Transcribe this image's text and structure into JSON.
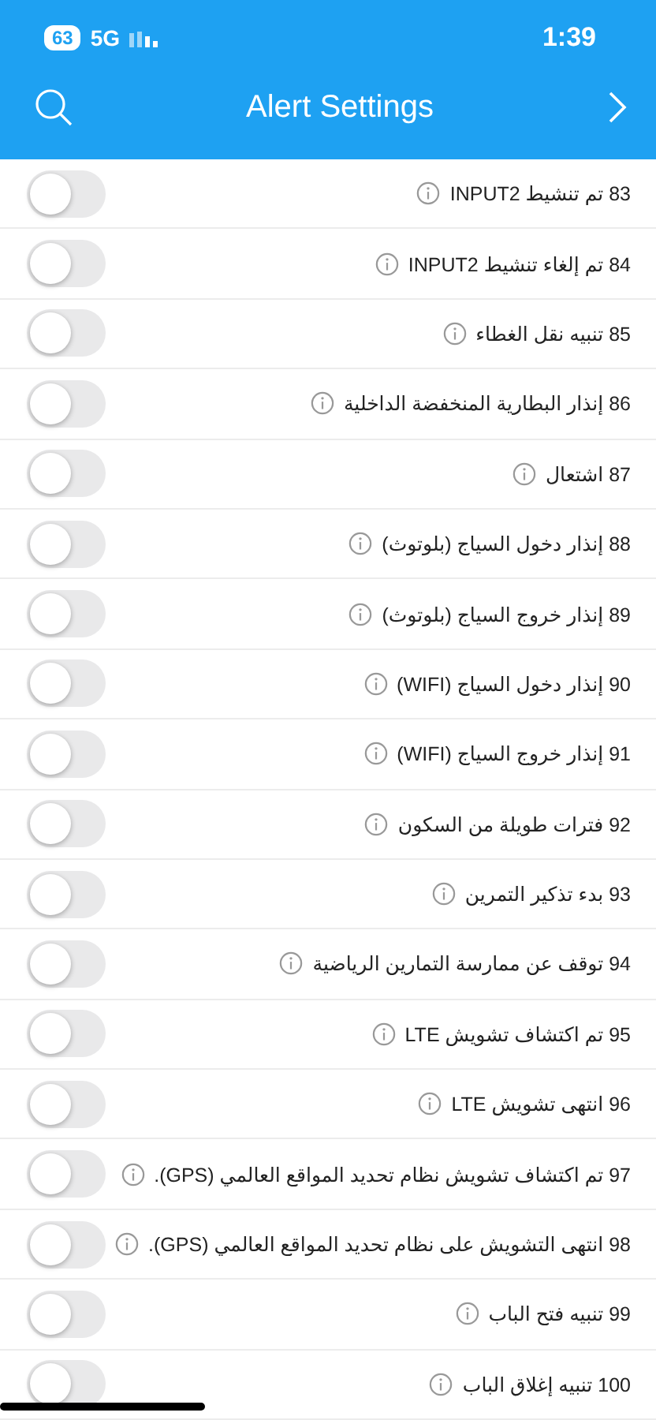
{
  "status_bar": {
    "battery": "63",
    "network": "5G",
    "time": "1:39"
  },
  "header": {
    "title": "Alert Settings"
  },
  "alerts": [
    {
      "label": "83 تم تنشيط INPUT2",
      "on": false
    },
    {
      "label": "84 تم إلغاء تنشيط INPUT2",
      "on": false
    },
    {
      "label": "85 تنبيه نقل الغطاء",
      "on": false
    },
    {
      "label": "86 إنذار البطارية المنخفضة الداخلية",
      "on": false
    },
    {
      "label": "87 اشتعال",
      "on": false
    },
    {
      "label": "88 إنذار دخول السياج (بلوتوث)",
      "on": false
    },
    {
      "label": "89 إنذار خروج السياج (بلوتوث)",
      "on": false
    },
    {
      "label": "90 إنذار دخول السياج (WIFI)",
      "on": false
    },
    {
      "label": "91 إنذار خروج السياج (WIFI)",
      "on": false
    },
    {
      "label": "92 فترات طويلة من السكون",
      "on": false
    },
    {
      "label": "93 بدء تذكير التمرين",
      "on": false
    },
    {
      "label": "94 توقف عن ممارسة التمارين الرياضية",
      "on": false
    },
    {
      "label": "95 تم اكتشاف تشويش LTE",
      "on": false
    },
    {
      "label": "96 انتهى تشويش LTE",
      "on": false
    },
    {
      "label": "97 تم اكتشاف تشويش نظام تحديد المواقع العالمي (GPS).",
      "on": false
    },
    {
      "label": "98 انتهى التشويش على نظام تحديد المواقع العالمي (GPS).",
      "on": false
    },
    {
      "label": "99 تنبيه فتح الباب",
      "on": false
    },
    {
      "label": "100 تنبيه إغلاق الباب",
      "on": false
    }
  ]
}
